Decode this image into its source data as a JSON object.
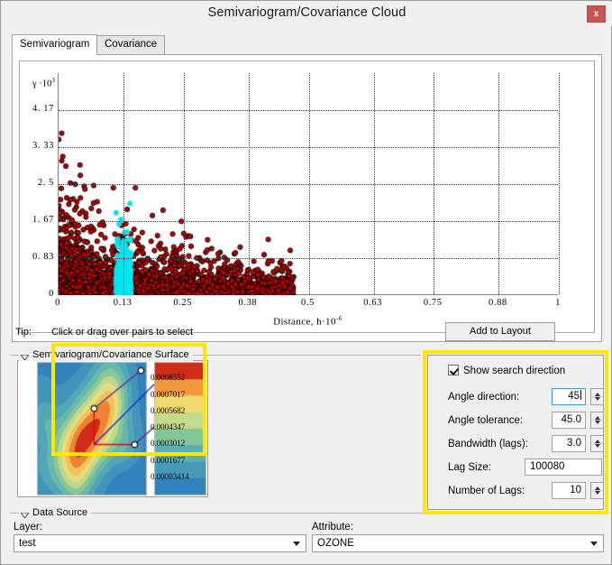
{
  "window": {
    "title": "Semivariogram/Covariance Cloud",
    "close_label": "x"
  },
  "tabs": [
    {
      "label": "Semivariogram",
      "active": true
    },
    {
      "label": "Covariance",
      "active": false
    }
  ],
  "chart_data": {
    "type": "scatter",
    "title": "",
    "xlabel": "Distance,  h·10",
    "xlabel_exp": "-6",
    "ylabel": "γ ·10",
    "ylabel_exp": "3",
    "xticks": [
      "0",
      "0.13",
      "0.25",
      "0.38",
      "0.5",
      "0.63",
      "0.75",
      "0.88",
      "1"
    ],
    "xtick_values": [
      0,
      0.13,
      0.25,
      0.38,
      0.5,
      0.63,
      0.75,
      0.88,
      1
    ],
    "yticks": [
      "4. 17",
      "3. 33",
      "2. 5",
      "1. 67",
      "0. 83",
      "0"
    ],
    "ytick_values": [
      4.17,
      3.33,
      2.5,
      1.67,
      0.83,
      0
    ],
    "xlim": [
      0,
      1
    ],
    "ylim": [
      0,
      5.0
    ],
    "grid": true,
    "legend": "none",
    "point_color": "#cc0000",
    "point_edge_color": "#000000",
    "selected_color": "#00e5f0",
    "selection_band": [
      0.115,
      0.145
    ],
    "n_points": 2600,
    "description": "Semivariogram cloud: dense red point cloud concentrated between distance 0 and 0.47, decaying in density and gamma with distance; a vertical cyan band of selected pairs near h = 0.13."
  },
  "tip": {
    "label": "Tip:",
    "text": "Click or drag over pairs to select"
  },
  "buttons": {
    "add_to_layout": "Add to Layout"
  },
  "surface_group": {
    "title": "Semivariogram/Covariance Surface",
    "legend_values": [
      "0.0008352",
      "0.0007017",
      "0.0005682",
      "0.0004347",
      "0.0003012",
      "0.0001677",
      "0.00003414"
    ]
  },
  "settings": {
    "show_search_direction": {
      "label": "Show search direction",
      "checked": true
    },
    "fields": [
      {
        "label": "Angle direction:",
        "value": "45",
        "spinner": true,
        "focused": true
      },
      {
        "label": "Angle tolerance:",
        "value": "45.0",
        "spinner": true,
        "focused": false
      },
      {
        "label": "Bandwidth (lags):",
        "value": "3.0",
        "spinner": true,
        "focused": false
      },
      {
        "label": "Lag Size:",
        "value": "100080",
        "spinner": false,
        "focused": false
      },
      {
        "label": "Number of Lags:",
        "value": "10",
        "spinner": true,
        "focused": false
      }
    ]
  },
  "data_source": {
    "title": "Data Source",
    "layer_label": "Layer:",
    "layer_value": "test",
    "attribute_label": "Attribute:",
    "attribute_value": "OZONE"
  },
  "colors": {
    "highlight": "#ffe800",
    "close_button": "#c75450",
    "focus_border": "#3f9ad6"
  }
}
